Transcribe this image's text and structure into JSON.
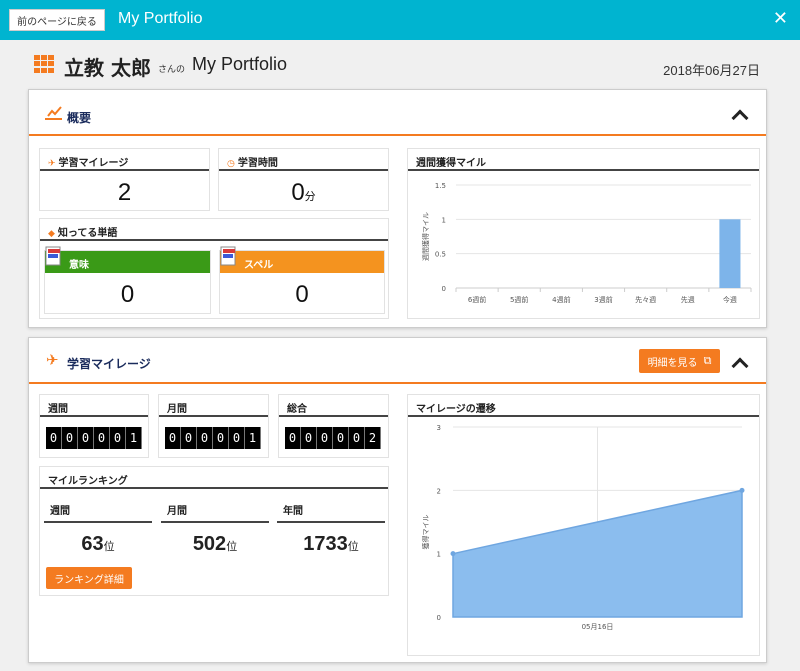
{
  "topbar": {
    "back_label": "前のページに戻る",
    "title": "My Portfolio",
    "close": "✕"
  },
  "header": {
    "user_name": "立教 太郎",
    "san": "さんの",
    "title": "My Portfolio",
    "date": "2018年06月27日"
  },
  "overview": {
    "title": "概要",
    "mileage": {
      "title": "学習マイレージ",
      "value": "2"
    },
    "study_time": {
      "title": "学習時間",
      "value": "0",
      "unit": "分"
    },
    "known_words": {
      "title": "知ってる単語",
      "meaning": {
        "label": "意味",
        "value": "0"
      },
      "spell": {
        "label": "スペル",
        "value": "0"
      }
    },
    "weekly_chart": {
      "title": "週間獲得マイル",
      "ylabel": "週間獲得マイル"
    }
  },
  "mileage_section": {
    "title": "学習マイレージ",
    "detail_button": "明細を見る",
    "weekly": {
      "label": "週間",
      "digits": [
        "0",
        "0",
        "0",
        "0",
        "0",
        "1"
      ]
    },
    "monthly": {
      "label": "月間",
      "digits": [
        "0",
        "0",
        "0",
        "0",
        "0",
        "1"
      ]
    },
    "total": {
      "label": "総合",
      "digits": [
        "0",
        "0",
        "0",
        "0",
        "0",
        "2"
      ]
    },
    "ranking": {
      "title": "マイルランキング",
      "weekly": {
        "label": "週間",
        "value": "63",
        "unit": "位"
      },
      "monthly": {
        "label": "月間",
        "value": "502",
        "unit": "位"
      },
      "yearly": {
        "label": "年間",
        "value": "1733",
        "unit": "位"
      },
      "button": "ランキング詳細"
    },
    "transition_chart": {
      "title": "マイレージの遷移",
      "ylabel": "獲得マイル"
    }
  },
  "colors": {
    "accent": "#f47b20",
    "topbar": "#00b4d0",
    "meaning": "#3a9a17",
    "spell": "#f4931f",
    "bar": "#7db4ea"
  },
  "chart_data": [
    {
      "type": "bar",
      "categories": [
        "6週前",
        "5週前",
        "4週前",
        "3週前",
        "先々週",
        "先週",
        "今週"
      ],
      "values": [
        0,
        0,
        0,
        0,
        0,
        0,
        1
      ],
      "ylabel": "週間獲得マイル",
      "ylim": [
        0,
        1.5
      ],
      "yticks": [
        "0",
        "0.5",
        "1",
        "1.5"
      ],
      "grid": true
    },
    {
      "type": "area",
      "x": [
        "05月16日"
      ],
      "points": [
        1,
        2
      ],
      "ylabel": "獲得マイル",
      "ylim": [
        0,
        3
      ],
      "yticks": [
        "0",
        "1",
        "2",
        "3"
      ],
      "grid": true
    }
  ]
}
